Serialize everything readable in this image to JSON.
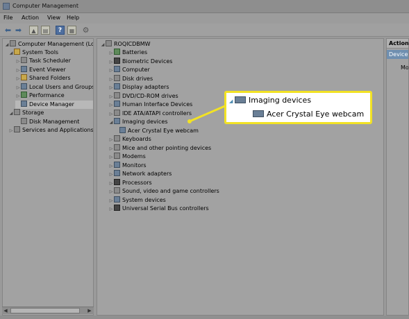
{
  "window": {
    "title": "Computer Management"
  },
  "menu": {
    "file": "File",
    "action": "Action",
    "view": "View",
    "help": "Help"
  },
  "toolbar": {
    "icons": [
      "back-arrow-icon",
      "forward-arrow-icon",
      "up-folder-icon",
      "show-hide-tree-icon",
      "help-icon",
      "properties-icon",
      "device-icon"
    ]
  },
  "left_tree": {
    "root": "Computer Management (Local",
    "system_tools": "System Tools",
    "task_scheduler": "Task Scheduler",
    "event_viewer": "Event Viewer",
    "shared_folders": "Shared Folders",
    "local_users": "Local Users and Groups",
    "performance": "Performance",
    "device_manager": "Device Manager",
    "storage": "Storage",
    "disk_management": "Disk Management",
    "services": "Services and Applications"
  },
  "devices": {
    "computer": "ROQICDBMW",
    "items": [
      "Batteries",
      "Biometric Devices",
      "Computer",
      "Disk drives",
      "Display adapters",
      "DVD/CD-ROM drives",
      "Human Interface Devices",
      "IDE ATA/ATAPI controllers",
      "Imaging devices",
      "Acer Crystal Eye webcam",
      "Keyboards",
      "Mice and other pointing devices",
      "Modems",
      "Monitors",
      "Network adapters",
      "Processors",
      "Sound, video and game controllers",
      "System devices",
      "Universal Serial Bus controllers"
    ]
  },
  "actions": {
    "header": "Actions",
    "item": "Device",
    "more": "Mo"
  },
  "callout": {
    "line1": "Imaging devices",
    "line2": "Acer Crystal Eye webcam",
    "border_color": "#f2e224"
  }
}
